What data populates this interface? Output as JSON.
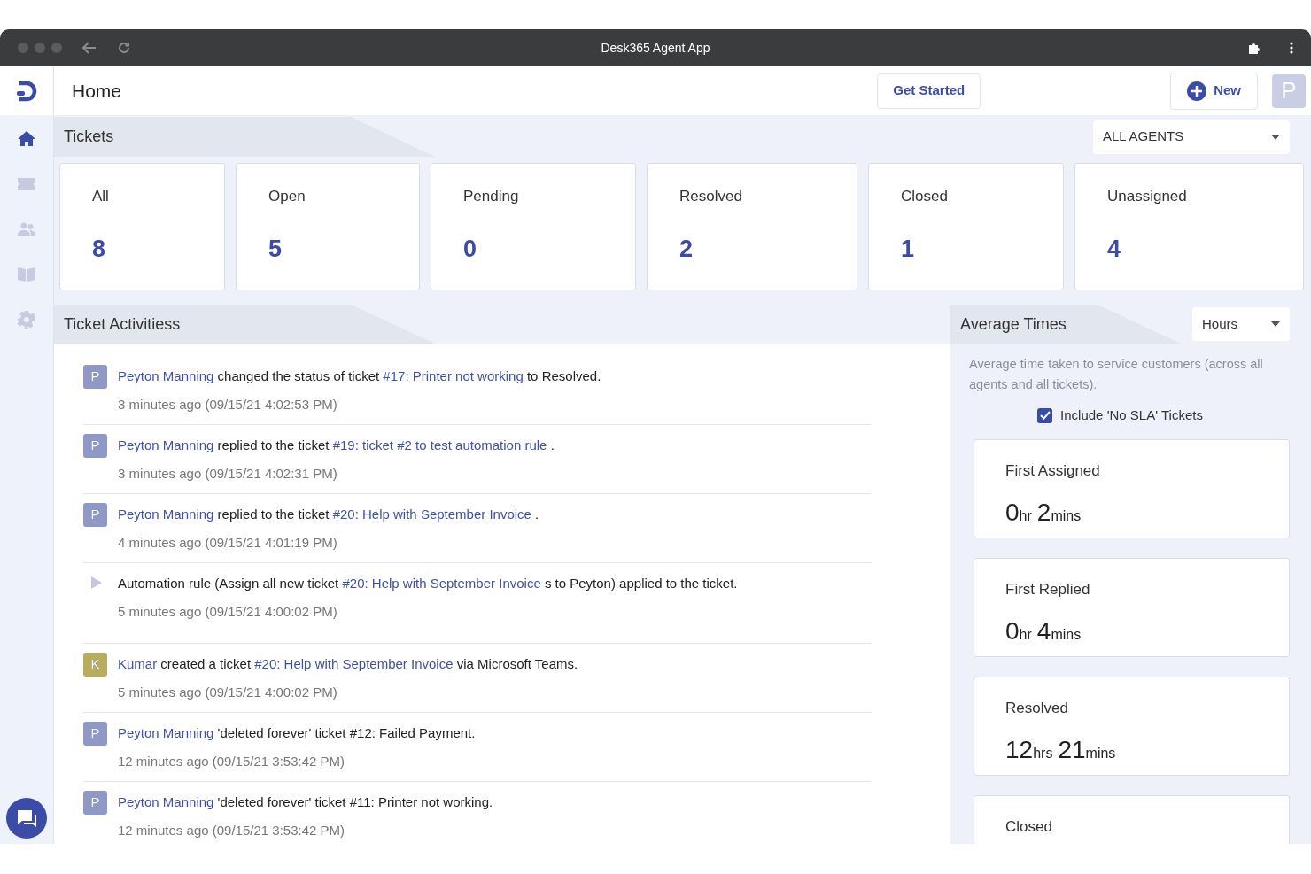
{
  "window": {
    "title": "Desk365 Agent App"
  },
  "header": {
    "title": "Home",
    "get_started": "Get Started",
    "new_button": "New",
    "avatar": "P"
  },
  "sidebar": {
    "items": [
      {
        "kind": "home",
        "selected": true
      },
      {
        "kind": "tickets",
        "selected": false
      },
      {
        "kind": "contacts",
        "selected": false
      },
      {
        "kind": "knowledge",
        "selected": false
      },
      {
        "kind": "settings",
        "selected": false
      }
    ]
  },
  "tickets": {
    "title": "Tickets",
    "agent_filter": "ALL AGENTS",
    "cards": [
      {
        "label": "All",
        "count": "8"
      },
      {
        "label": "Open",
        "count": "5"
      },
      {
        "label": "Pending",
        "count": "0"
      },
      {
        "label": "Resolved",
        "count": "2"
      },
      {
        "label": "Closed",
        "count": "1"
      },
      {
        "label": "Unassigned",
        "count": "4"
      }
    ]
  },
  "activities": {
    "title": "Ticket Activitiess",
    "items": [
      {
        "kind": "user",
        "avatar": "P",
        "color": "#9098c8",
        "parts": [
          {
            "text": "Peyton Manning",
            "link": true
          },
          {
            "text": " changed the status of ticket ",
            "link": false
          },
          {
            "text": "#17: Printer not working",
            "link": true
          },
          {
            "text": " to Resolved.",
            "link": false
          }
        ],
        "time": "3 minutes ago (09/15/21 4:02:53 PM)"
      },
      {
        "kind": "user",
        "avatar": "P",
        "color": "#9098c8",
        "parts": [
          {
            "text": "Peyton Manning",
            "link": true
          },
          {
            "text": " replied to the ticket ",
            "link": false
          },
          {
            "text": "#19: ticket #2 to test automation rule",
            "link": true
          },
          {
            "text": " .",
            "link": false
          }
        ],
        "time": "3 minutes ago (09/15/21 4:02:31 PM)"
      },
      {
        "kind": "user",
        "avatar": "P",
        "color": "#9098c8",
        "parts": [
          {
            "text": "Peyton Manning",
            "link": true
          },
          {
            "text": " replied to the ticket ",
            "link": false
          },
          {
            "text": "#20: Help with September Invoice",
            "link": true
          },
          {
            "text": " .",
            "link": false
          }
        ],
        "time": "4 minutes ago (09/15/21 4:01:19 PM)"
      },
      {
        "kind": "automation",
        "parts": [
          {
            "text": "Automation rule (Assign all new ticket ",
            "link": false
          },
          {
            "text": "#20: Help with September Invoice",
            "link": true
          },
          {
            "text": " s to Peyton) applied to the ticket.",
            "link": false
          }
        ],
        "time": "5 minutes ago (09/15/21 4:00:02 PM)"
      },
      {
        "kind": "user",
        "avatar": "K",
        "color": "#b8ad5e",
        "parts": [
          {
            "text": "Kumar",
            "link": true
          },
          {
            "text": " created a ticket ",
            "link": false
          },
          {
            "text": "#20: Help with September Invoice",
            "link": true
          },
          {
            "text": " via Microsoft Teams.",
            "link": false
          }
        ],
        "time": "5 minutes ago (09/15/21 4:00:02 PM)"
      },
      {
        "kind": "user",
        "avatar": "P",
        "color": "#9098c8",
        "parts": [
          {
            "text": "Peyton Manning",
            "link": true
          },
          {
            "text": " 'deleted forever' ticket #12: Failed Payment.",
            "link": false
          }
        ],
        "time": "12 minutes ago (09/15/21 3:53:42 PM)"
      },
      {
        "kind": "user",
        "avatar": "P",
        "color": "#9098c8",
        "parts": [
          {
            "text": "Peyton Manning",
            "link": true
          },
          {
            "text": " 'deleted forever' ticket #11: Printer not working.",
            "link": false
          }
        ],
        "time": "12 minutes ago (09/15/21 3:53:42 PM)"
      }
    ]
  },
  "average_times": {
    "title": "Average Times",
    "unit_filter": "Hours",
    "description": "Average time taken to service customers (across all agents and all tickets).",
    "include_no_sla": {
      "label": "Include 'No SLA' Tickets",
      "checked": true
    },
    "cards": [
      {
        "label": "First Assigned",
        "value": [
          {
            "number": "0",
            "unit": "hr"
          },
          {
            "number": "2",
            "unit": "mins"
          }
        ]
      },
      {
        "label": "First Replied",
        "value": [
          {
            "number": "0",
            "unit": "hr"
          },
          {
            "number": "4",
            "unit": "mins"
          }
        ]
      },
      {
        "label": "Resolved",
        "value": [
          {
            "number": "12",
            "unit": "hrs"
          },
          {
            "number": "21",
            "unit": "mins"
          }
        ]
      },
      {
        "label": "Closed"
      }
    ]
  }
}
